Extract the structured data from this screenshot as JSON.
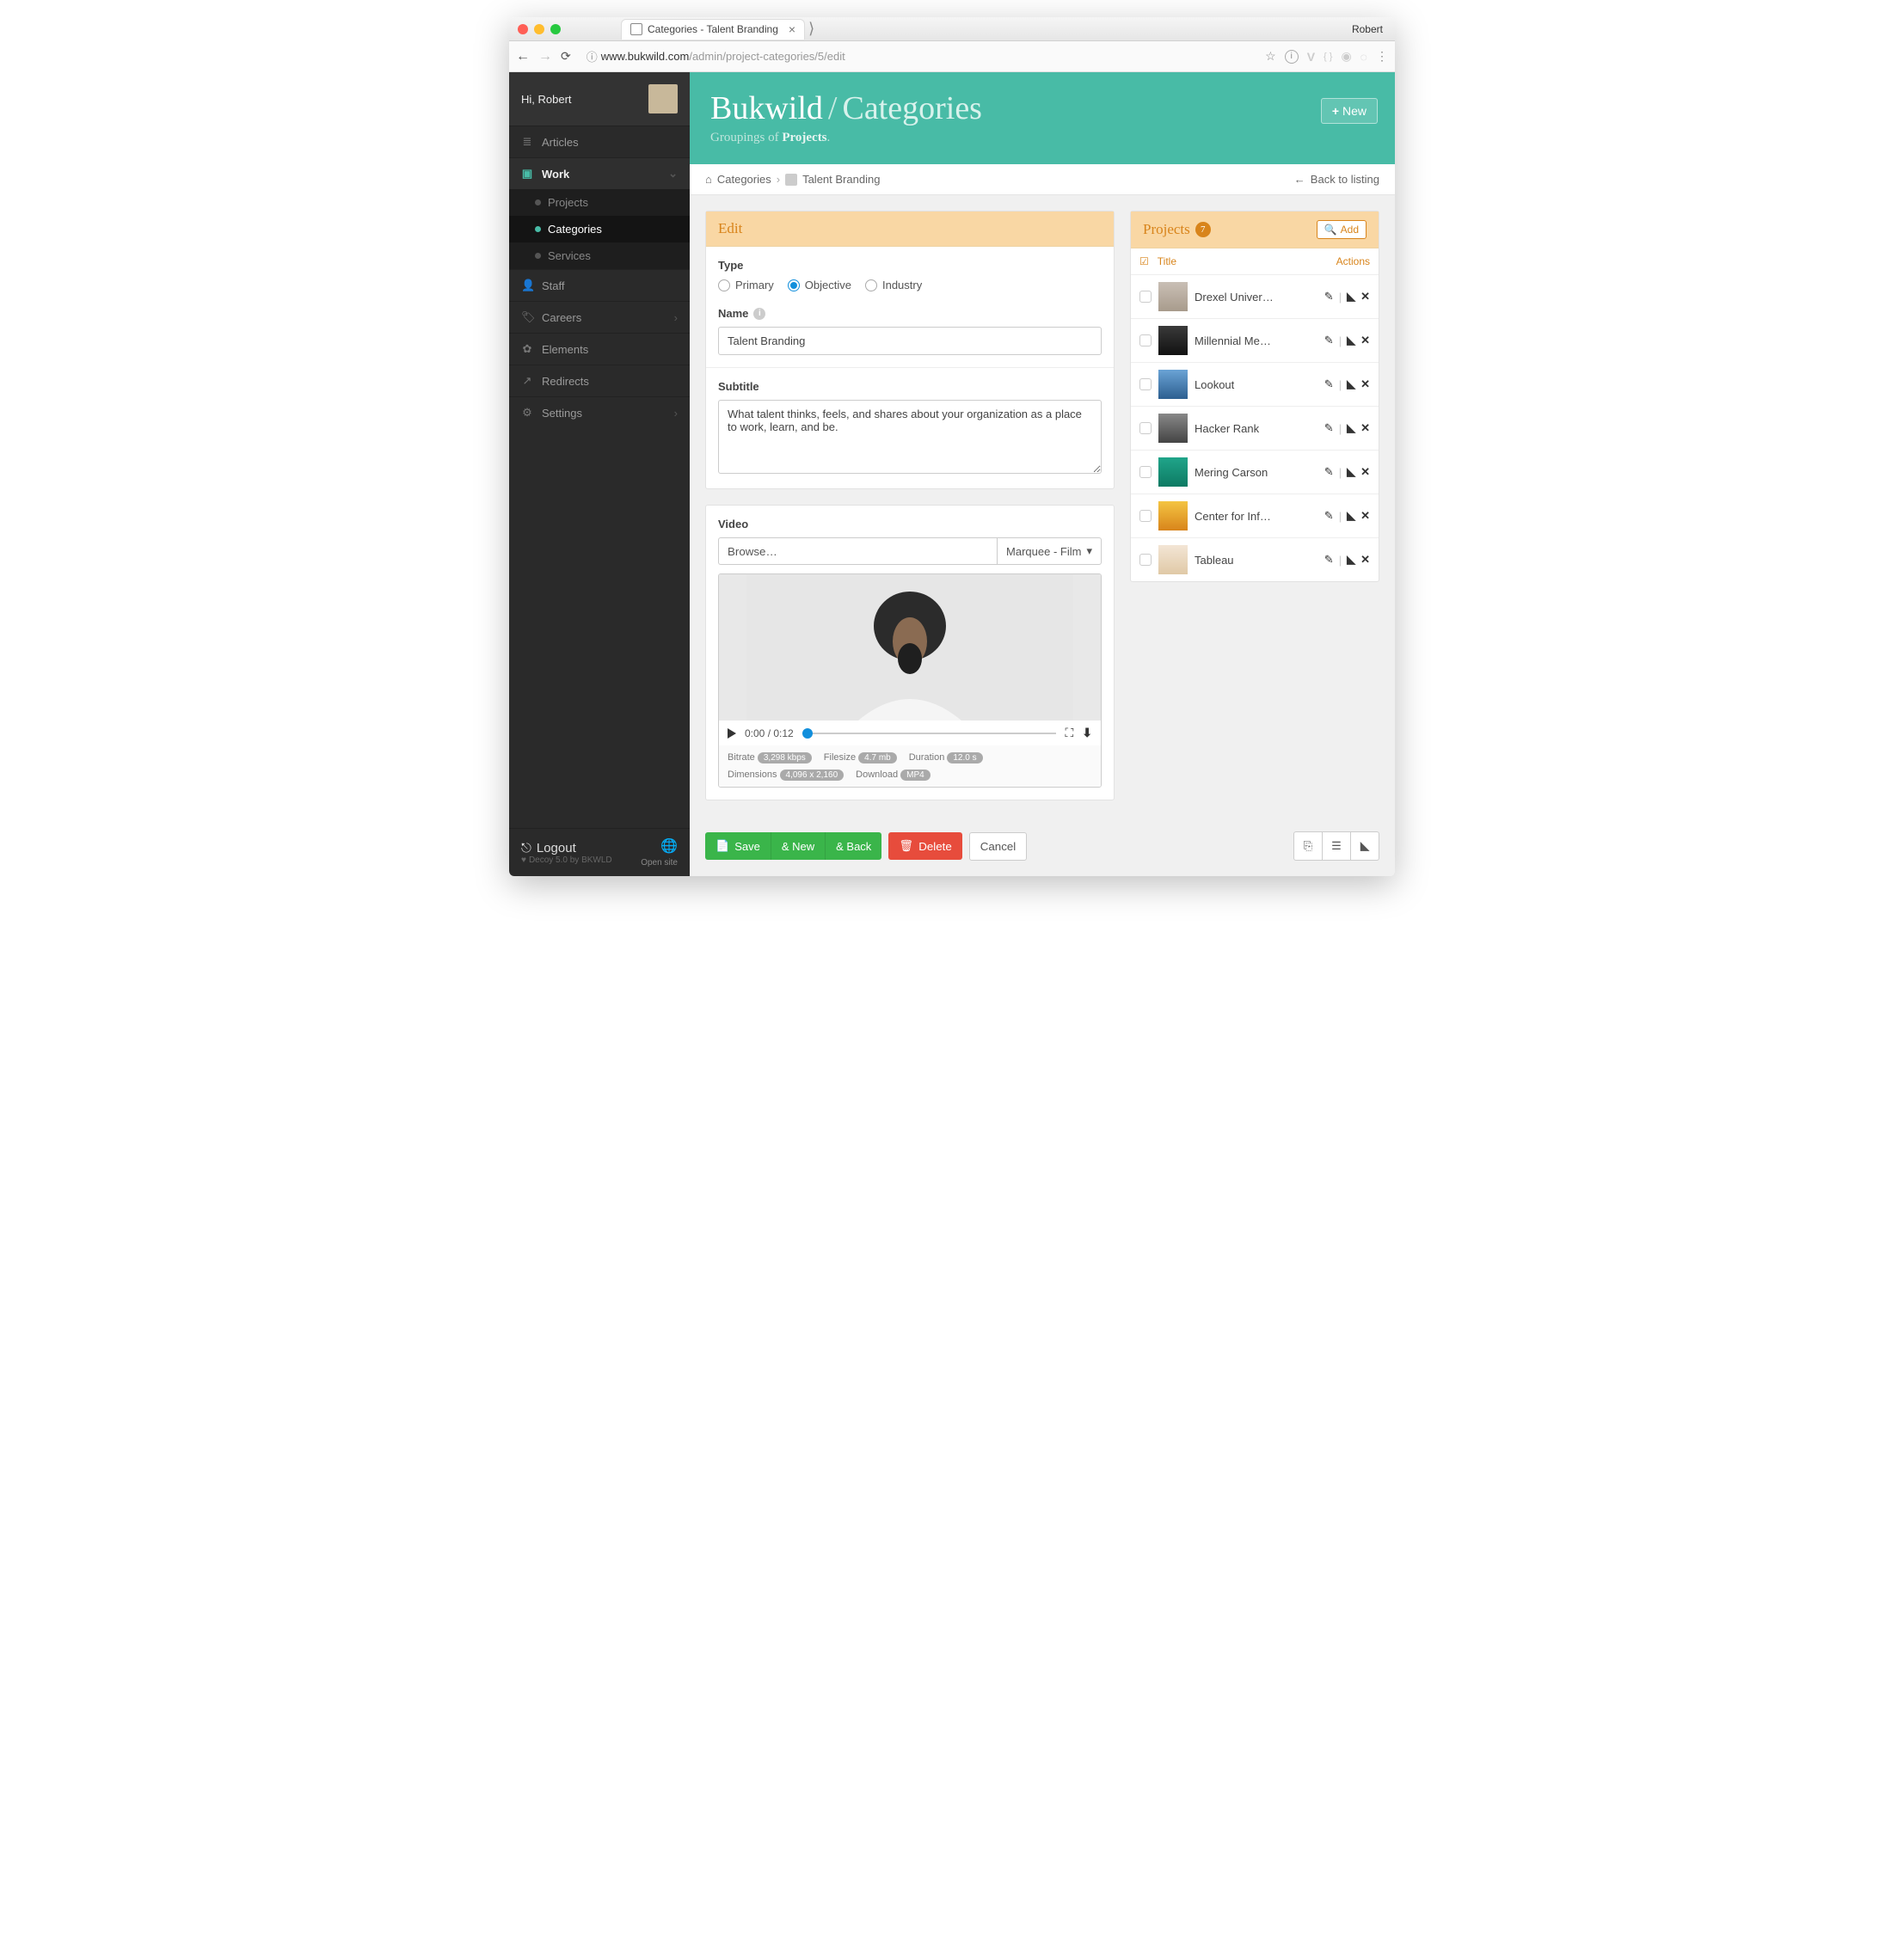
{
  "chrome": {
    "profile_name": "Robert",
    "tab_title": "Categories - Talent Branding",
    "url_host": "www.bukwild.com",
    "url_path": "/admin/project-categories/5/edit"
  },
  "sidebar": {
    "greeting": "Hi, Robert",
    "items": [
      {
        "label": "Articles",
        "icon": "list"
      },
      {
        "label": "Work",
        "icon": "briefcase",
        "open": true,
        "children": [
          {
            "label": "Projects"
          },
          {
            "label": "Categories",
            "active": true
          },
          {
            "label": "Services"
          }
        ]
      },
      {
        "label": "Staff",
        "icon": "person"
      },
      {
        "label": "Careers",
        "icon": "tag",
        "chev": true
      },
      {
        "label": "Elements",
        "icon": "leaf"
      },
      {
        "label": "Redirects",
        "icon": "external"
      },
      {
        "label": "Settings",
        "icon": "gear",
        "chev": true
      }
    ],
    "logout": "Logout",
    "footer_meta": "Decoy 5.0 by BKWLD",
    "open_site": "Open site"
  },
  "banner": {
    "brand": "Bukwild",
    "section": "Categories",
    "subtitle_a": "Groupings of ",
    "subtitle_b": "Projects",
    "subtitle_c": ".",
    "new_btn": "New"
  },
  "crumbs": {
    "root": "Categories",
    "leaf": "Talent Branding",
    "back": "Back to listing"
  },
  "form": {
    "edit_title": "Edit",
    "type_label": "Type",
    "types": [
      {
        "label": "Primary",
        "checked": false
      },
      {
        "label": "Objective",
        "checked": true
      },
      {
        "label": "Industry",
        "checked": false
      }
    ],
    "name_label": "Name",
    "name_value": "Talent Branding",
    "subtitle_label": "Subtitle",
    "subtitle_value": "What talent thinks, feels, and shares about your organization as a place to work, learn, and be.",
    "video_label": "Video",
    "browse": "Browse…",
    "select_label": "Marquee - Film",
    "time": "0:00 / 0:12",
    "meta": {
      "bitrate_k": "Bitrate",
      "bitrate_v": "3,298 kbps",
      "filesize_k": "Filesize",
      "filesize_v": "4.7 mb",
      "duration_k": "Duration",
      "duration_v": "12.0 s",
      "dim_k": "Dimensions",
      "dim_v": "4,096 x 2,160",
      "dl_k": "Download",
      "dl_v": "MP4"
    }
  },
  "actions": {
    "save": "Save",
    "new": "& New",
    "back": "& Back",
    "delete": "Delete",
    "cancel": "Cancel"
  },
  "projects": {
    "title": "Projects",
    "count": "7",
    "add": "Add",
    "col_title": "Title",
    "col_actions": "Actions",
    "items": [
      {
        "name": "Drexel Univer…"
      },
      {
        "name": "Millennial Me…"
      },
      {
        "name": "Lookout"
      },
      {
        "name": "Hacker Rank"
      },
      {
        "name": "Mering Carson"
      },
      {
        "name": "Center for Inf…"
      },
      {
        "name": "Tableau"
      }
    ]
  }
}
